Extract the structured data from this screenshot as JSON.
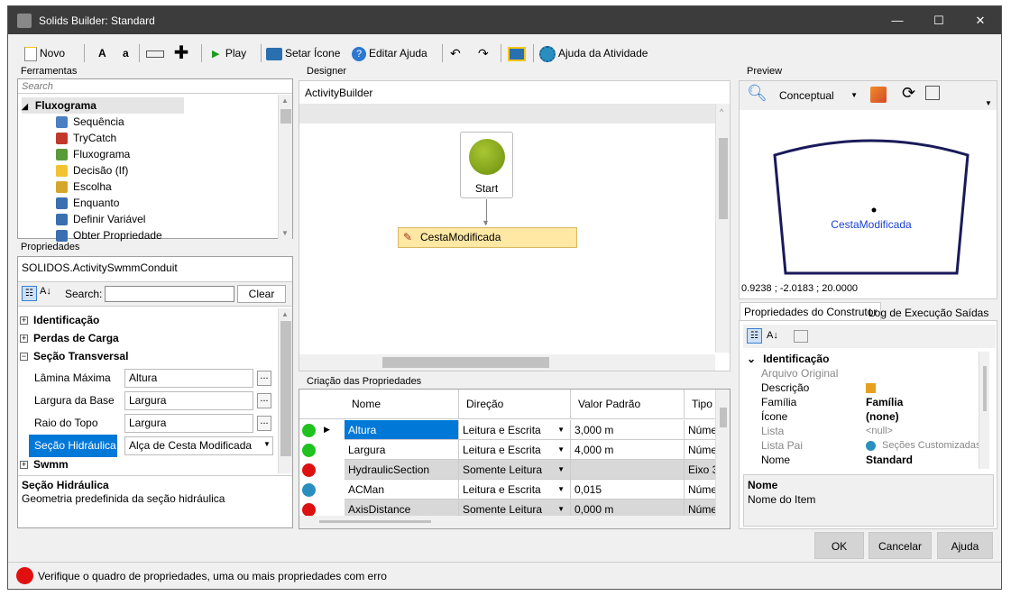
{
  "window": {
    "title": "Solids Builder: Standard",
    "minimize": "—",
    "maximize": "☐",
    "close": "✕"
  },
  "toolbar": {
    "novo": "Novo",
    "a_upper": "A",
    "a_lower": "a",
    "play": "Play",
    "setar_icone": "Setar Ícone",
    "editar_ajuda": "Editar Ajuda",
    "ajuda_atividade": "Ajuda da Atividade"
  },
  "ferramentas": {
    "label": "Ferramentas",
    "search_placeholder": "Search",
    "group": "Fluxograma",
    "items": [
      {
        "label": "Sequência",
        "color": "#4a7fc1"
      },
      {
        "label": "TryCatch",
        "color": "#c0392b"
      },
      {
        "label": "Fluxograma",
        "color": "#5a9a3a"
      },
      {
        "label": "Decisão (If)",
        "color": "#f2c230"
      },
      {
        "label": "Escolha",
        "color": "#d4a62a"
      },
      {
        "label": "Enquanto",
        "color": "#3a6fb0"
      },
      {
        "label": "Definir Variável",
        "color": "#3a6fb0"
      },
      {
        "label": "Obter Propriedade",
        "color": "#3a6fb0"
      }
    ]
  },
  "propriedades": {
    "label": "Propriedades",
    "object": "SOLIDOS.ActivitySwmmConduit",
    "search_label": "Search:",
    "clear": "Clear",
    "categories": [
      "Identificação",
      "Perdas de Carga",
      "Seção Transversal",
      "Swmm"
    ],
    "rows": [
      {
        "label": "Lâmina Máxima",
        "value": "Altura"
      },
      {
        "label": "Largura da Base",
        "value": "Largura"
      },
      {
        "label": "Raio do Topo",
        "value": "Largura"
      },
      {
        "label": "Seção Hidráulica",
        "value": "Alça de Cesta Modificada"
      }
    ],
    "desc_title": "Seção Hidráulica",
    "desc_text": "Geometria predefinida da seção hidráulica"
  },
  "designer": {
    "label": "Designer",
    "breadcrumb": "ActivityBuilder",
    "start": "Start",
    "activity": "CestaModificada"
  },
  "criacao": {
    "label": "Criação das Propriedades",
    "headers": [
      "Nome",
      "Direção",
      "Valor Padrão",
      "Tipo"
    ],
    "rows": [
      {
        "status": "#1fc21f",
        "name": "Altura",
        "dir": "Leitura e Escrita",
        "val": "3,000 m",
        "tipo": "Númer",
        "selected": true
      },
      {
        "status": "#1fc21f",
        "name": "Largura",
        "dir": "Leitura e Escrita",
        "val": "4,000 m",
        "tipo": "Númer",
        "selected": false
      },
      {
        "status": "#dd1111",
        "name": "HydraulicSection",
        "dir": "Somente Leitura",
        "val": "",
        "tipo": "Eixo 3",
        "selected": false
      },
      {
        "status": "#2a8fbf",
        "name": "ACMan",
        "dir": "Leitura e Escrita",
        "val": "0,015",
        "tipo": "Númer",
        "selected": false
      },
      {
        "status": "#dd1111",
        "name": "AxisDistance",
        "dir": "Somente Leitura",
        "val": "0,000 m",
        "tipo": "Númer",
        "selected": false
      }
    ]
  },
  "preview": {
    "label": "Preview",
    "mode": "Conceptual",
    "shape_label": "CestaModificada",
    "coords": "0.9238 ; -2.0183 ; 20.0000"
  },
  "construtor": {
    "tabs": [
      "Propriedades do Construtor",
      "Log de Execução",
      "Saídas"
    ],
    "category": "Identificação",
    "rows": [
      {
        "label": "Arquivo Original",
        "value": "",
        "disabled": true
      },
      {
        "label": "Descrição",
        "value": "",
        "disabled": false
      },
      {
        "label": "Família",
        "value": "Família",
        "disabled": false,
        "bold": true
      },
      {
        "label": "Ícone",
        "value": "(none)",
        "disabled": false,
        "bold": true
      },
      {
        "label": "Lista",
        "value": "<null>",
        "disabled": true
      },
      {
        "label": "Lista Pai",
        "value": "Seções Customizadas",
        "disabled": true
      },
      {
        "label": "Nome",
        "value": "Standard",
        "disabled": false,
        "bold": true
      }
    ],
    "desc_title": "Nome",
    "desc_text": "Nome do Item"
  },
  "buttons": {
    "ok": "OK",
    "cancel": "Cancelar",
    "help": "Ajuda"
  },
  "status": {
    "text": "Verifique o quadro de propriedades, uma ou mais propriedades com erro"
  }
}
